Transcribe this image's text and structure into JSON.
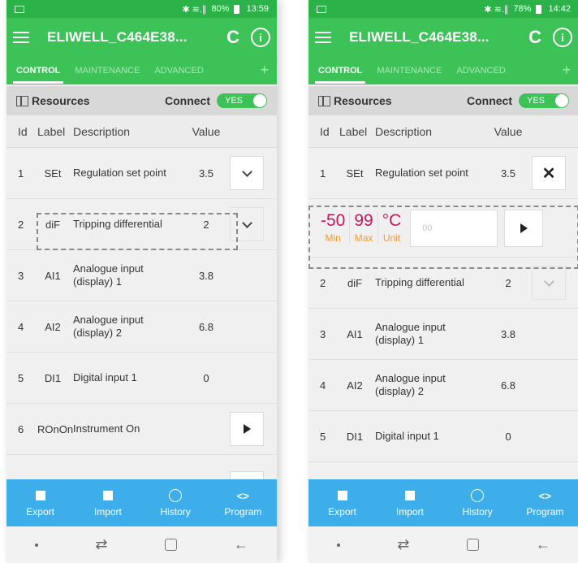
{
  "left": {
    "status": {
      "icons": "✱ ≋.∥",
      "battery": "80%",
      "time": "13:59"
    },
    "appbar": {
      "title": "ELIWELL_C464E38...",
      "refresh_glyph": "C",
      "info_glyph": "i"
    },
    "tabs": [
      "CONTROL",
      "MAINTENANCE",
      "ADVANCED"
    ],
    "tab_plus": "+",
    "resources": {
      "label": "Resources",
      "connect_label": "Connect",
      "toggle_text": "YES"
    },
    "table_header": {
      "id": "Id",
      "label": "Label",
      "description": "Description",
      "value": "Value"
    },
    "rows": [
      {
        "id": "1",
        "label": "SEt",
        "description": "Regulation set point",
        "value": "3.5",
        "action": "chevron-down"
      },
      {
        "id": "2",
        "label": "diF",
        "description": "Tripping differential",
        "value": "2",
        "action": "chevron-down"
      },
      {
        "id": "3",
        "label": "AI1",
        "description": "Analogue input (display) 1",
        "value": "3.8",
        "action": ""
      },
      {
        "id": "4",
        "label": "AI2",
        "description": "Analogue input (display) 2",
        "value": "6.8",
        "action": ""
      },
      {
        "id": "5",
        "label": "DI1",
        "description": "Digital input 1",
        "value": "0",
        "action": ""
      },
      {
        "id": "6",
        "label": "ROnOn",
        "description": "Instrument On",
        "value": "",
        "action": "play"
      }
    ]
  },
  "right": {
    "status": {
      "icons": "✱ ≋.∥",
      "battery": "78%",
      "time": "14:42"
    },
    "appbar": {
      "title": "ELIWELL_C464E38...",
      "refresh_glyph": "C",
      "info_glyph": "i"
    },
    "tabs": [
      "CONTROL",
      "MAINTENANCE",
      "ADVANCED"
    ],
    "tab_plus": "+",
    "resources": {
      "label": "Resources",
      "connect_label": "Connect",
      "toggle_text": "YES"
    },
    "table_header": {
      "id": "Id",
      "label": "Label",
      "description": "Description",
      "value": "Value"
    },
    "row_set": {
      "id": "1",
      "label": "SEt",
      "description": "Regulation set point",
      "value": "3.5"
    },
    "editor": {
      "min": {
        "value": "-50",
        "caption": "Min"
      },
      "max": {
        "value": "99",
        "caption": "Max"
      },
      "unit": {
        "value": "°C",
        "caption": "Unit"
      },
      "input_placeholder": "00"
    },
    "rows": [
      {
        "id": "2",
        "label": "diF",
        "description": "Tripping differential",
        "value": "2"
      },
      {
        "id": "3",
        "label": "AI1",
        "description": "Analogue input (display) 1",
        "value": "3.8"
      },
      {
        "id": "4",
        "label": "AI2",
        "description": "Analogue input (display) 2",
        "value": "6.8"
      },
      {
        "id": "5",
        "label": "DI1",
        "description": "Digital input 1",
        "value": "0"
      }
    ]
  },
  "bottom_nav": [
    "Export",
    "Import",
    "History",
    "Program"
  ],
  "colors": {
    "green": "#3cc257",
    "status_green": "#2bb34a",
    "blue": "#3daee9",
    "limit_red": "#c2185b",
    "caption_orange": "#f29a2e"
  }
}
